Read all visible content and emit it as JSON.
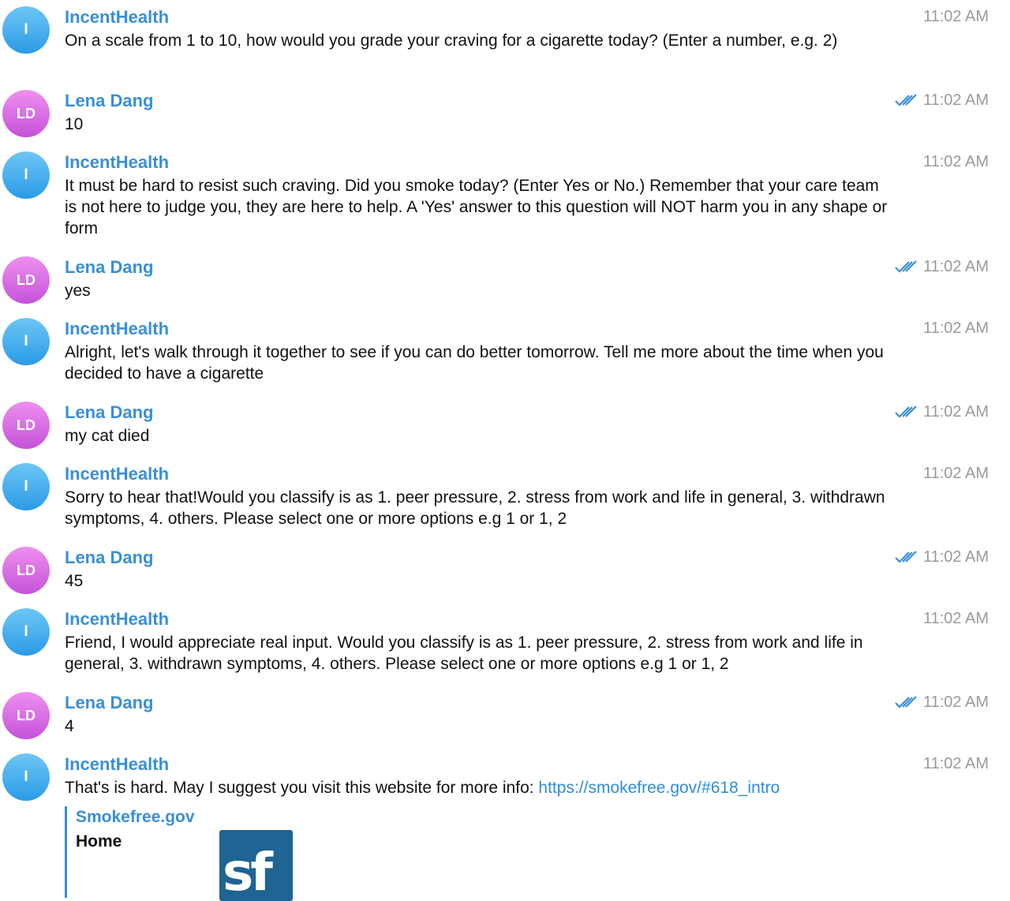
{
  "bot_name": "IncentHealth",
  "user_name": "Lena Dang",
  "bot_initial": "I",
  "user_initials": "LD",
  "colors": {
    "accent": "#3a8fd6",
    "time": "#9a9a9a",
    "bot_avatar": "#2a9be6",
    "user_avatar": "#c453d9"
  },
  "messages": [
    {
      "time": "11:02 AM",
      "text": "On a scale from 1 to 10, how would you grade your craving for a cigarette today? (Enter a number, e.g. 2)"
    },
    {
      "time": "11:02 AM",
      "text": "10"
    },
    {
      "time": "11:02 AM",
      "text": "It must be hard to resist such craving.  Did you smoke today? (Enter Yes or No.) Remember that your care team is not here to judge you, they are here to help.  A 'Yes' answer to this question will NOT harm you in any shape or form"
    },
    {
      "time": "11:02 AM",
      "text": "yes"
    },
    {
      "time": "11:02 AM",
      "text": "Alright, let's walk through it together to see if you can do better tomorrow. Tell me more about the time when you decided to have a cigarette"
    },
    {
      "time": "11:02 AM",
      "text": "my cat died"
    },
    {
      "time": "11:02 AM",
      "text": "Sorry to hear that!Would you classify is as 1. peer pressure, 2. stress from work and life in general, 3. withdrawn symptoms, 4. others. Please select one or more options e.g 1 or 1, 2"
    },
    {
      "time": "11:02 AM",
      "text": "45"
    },
    {
      "time": "11:02 AM",
      "text": "Friend, I would appreciate real input. Would you classify is as 1. peer pressure, 2. stress from work and life in general, 3. withdrawn symptoms, 4. others. Please select one or more options e.g 1 or 1, 2"
    },
    {
      "time": "11:02 AM",
      "text": "4"
    },
    {
      "time": "11:02 AM",
      "text": "That's is hard. May I suggest you visit this website for more info: ",
      "link": "https://smokefree.gov/#618_intro"
    }
  ],
  "link_preview": {
    "site": "Smokefree.gov",
    "title": "Home",
    "thumb_text": "sf"
  }
}
